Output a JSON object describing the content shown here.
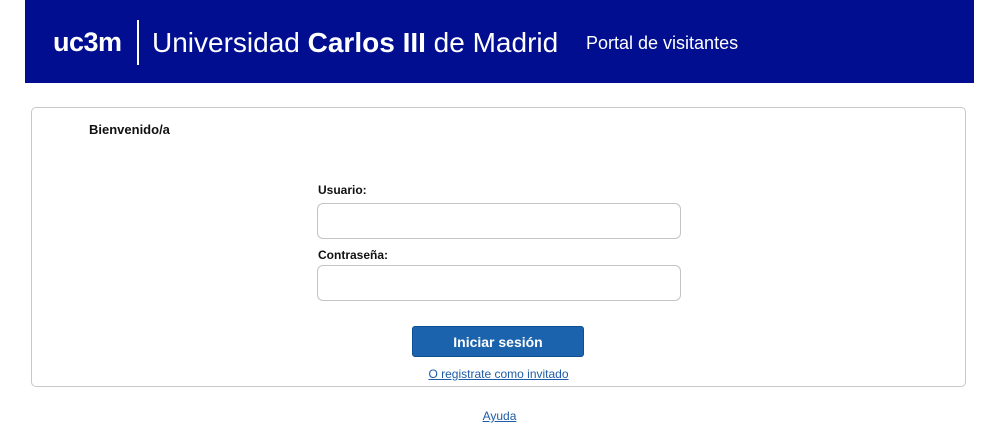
{
  "header": {
    "logo_mark": "uc3m",
    "university_prefix": "Universidad ",
    "university_bold": "Carlos III",
    "university_suffix": " de Madrid",
    "portal_title": "Portal de visitantes"
  },
  "login": {
    "welcome": "Bienvenido/a",
    "username_label": "Usuario:",
    "username_value": "",
    "password_label": "Contraseña:",
    "password_value": "",
    "submit_label": "Iniciar sesión",
    "guest_link": "O registrate como invitado"
  },
  "footer": {
    "help_link": "Ayuda"
  },
  "colors": {
    "header_bg": "#000e8f",
    "button_bg": "#1b64ad",
    "link": "#1f5ca8"
  }
}
